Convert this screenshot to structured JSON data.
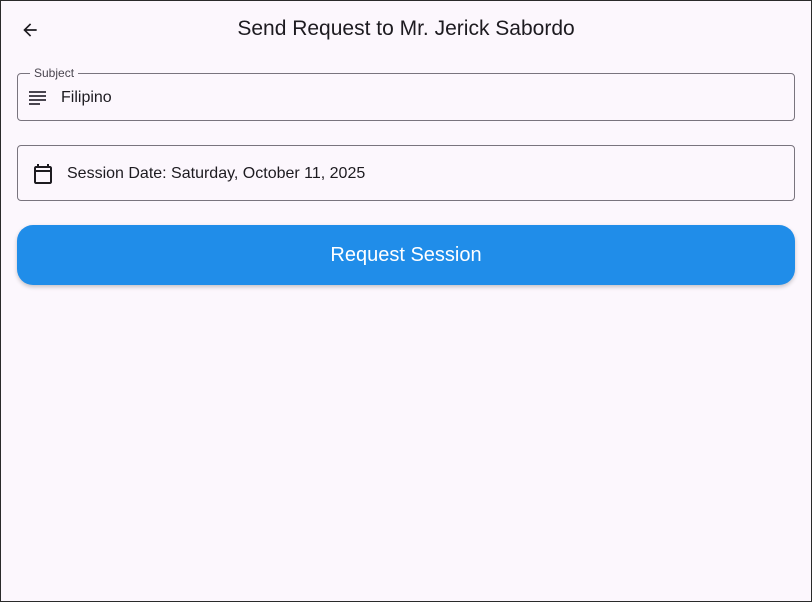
{
  "app_bar": {
    "back_icon": "arrow-back-icon",
    "title": "Send Request to Mr. Jerick Sabordo"
  },
  "subject": {
    "label": "Subject",
    "icon": "notes-icon",
    "value": "Filipino"
  },
  "session_date": {
    "icon": "calendar-icon",
    "text": "Session Date: Saturday, October 11, 2025"
  },
  "request_button": {
    "label": "Request Session",
    "color": "#208de9"
  },
  "colors": {
    "background": "#fcf7fd",
    "outline": "#79747e",
    "text": "#1d1b20"
  }
}
